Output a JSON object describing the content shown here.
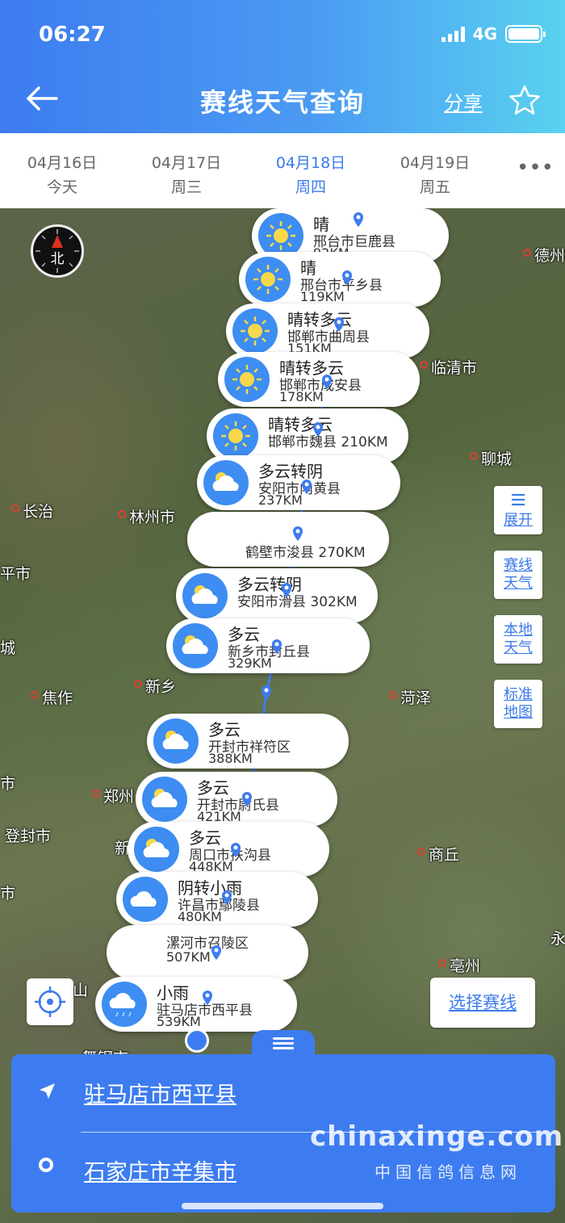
{
  "status": {
    "time": "06:27",
    "network": "4G"
  },
  "header": {
    "title": "赛线天气查询",
    "share_label": "分享"
  },
  "tabs": [
    {
      "date": "04月16日",
      "day": "今天",
      "active": false
    },
    {
      "date": "04月17日",
      "day": "周三",
      "active": false
    },
    {
      "date": "04月18日",
      "day": "周四",
      "active": true
    },
    {
      "date": "04月19日",
      "day": "周五",
      "active": false
    }
  ],
  "compass_label": "北",
  "cities": [
    "德州",
    "临清市",
    "聊城",
    "长治",
    "林州市",
    "平市",
    "城",
    "新乡",
    "焦作",
    "菏泽",
    "郑州",
    "市",
    "登封市",
    "新",
    "商丘",
    "市",
    "亳州",
    "永",
    "山",
    "舞钢市"
  ],
  "stops": [
    {
      "weather": "晴",
      "place": "邢台市巨鹿县",
      "km": "92KM",
      "icon": "sun-icon"
    },
    {
      "weather": "晴",
      "place": "邢台市平乡县",
      "km": "119KM",
      "icon": "sun-icon"
    },
    {
      "weather": "晴转多云",
      "place": "邯郸市曲周县",
      "km": "151KM",
      "icon": "sun-icon"
    },
    {
      "weather": "晴转多云",
      "place": "邯郸市成安县",
      "km": "178KM",
      "icon": "sun-icon"
    },
    {
      "weather": "晴转多云",
      "place": "邯郸市魏县 210KM",
      "km": "",
      "icon": "sun-icon"
    },
    {
      "weather": "多云转阴",
      "place": "安阳市内黄县",
      "km": "237KM",
      "icon": "cloud-sun-icon"
    },
    {
      "weather": "",
      "place": "鹤壁市浚县 270KM",
      "km": "",
      "icon": ""
    },
    {
      "weather": "多云转阴",
      "place": "安阳市滑县 302KM",
      "km": "",
      "icon": "cloud-sun-icon"
    },
    {
      "weather": "多云",
      "place": "新乡市封丘县",
      "km": "329KM",
      "icon": "cloud-sun-icon"
    },
    {
      "weather": "多云",
      "place": "开封市祥符区",
      "km": "388KM",
      "icon": "cloud-sun-icon"
    },
    {
      "weather": "多云",
      "place": "开封市尉氏县",
      "km": "421KM",
      "icon": "cloud-sun-icon"
    },
    {
      "weather": "多云",
      "place": "周口市扶沟县",
      "km": "448KM",
      "icon": "cloud-sun-icon"
    },
    {
      "weather": "阴转小雨",
      "place": "许昌市鄢陵县",
      "km": "480KM",
      "icon": "cloud-icon"
    },
    {
      "weather": "",
      "place": "漯河市召陵区",
      "km": "507KM",
      "icon": ""
    },
    {
      "weather": "小雨",
      "place": "驻马店市西平县",
      "km": "539KM",
      "icon": "rain-icon"
    }
  ],
  "side_buttons": [
    {
      "line1": "",
      "line2": "展开"
    },
    {
      "line1": "赛线",
      "line2": "天气"
    },
    {
      "line1": "本地",
      "line2": "天气"
    },
    {
      "line1": "标准",
      "line2": "地图"
    }
  ],
  "choose_route": "选择赛线",
  "route": {
    "start": "驻马店市西平县",
    "end": "石家庄市辛集市"
  },
  "watermark": {
    "main": "chinaxinge.com",
    "sub": "中国信鸽信息网"
  },
  "colors": {
    "accent": "#3d7cf0",
    "sun_bg": "#3d8df2"
  }
}
